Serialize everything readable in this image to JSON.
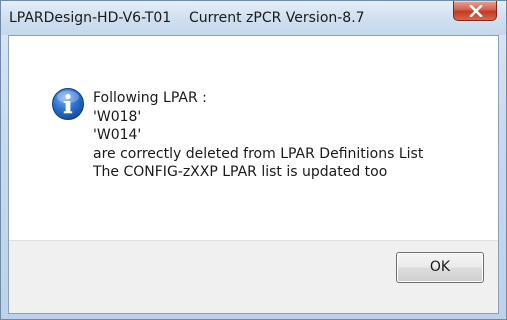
{
  "window": {
    "title": "LPARDesign-HD-V6-T01    Current zPCR Version-8.7",
    "close_icon": "close-icon"
  },
  "dialog": {
    "icon": "info-icon",
    "message_lines": [
      "Following LPAR :",
      "'W018'",
      "'W014'",
      "are correctly deleted from LPAR Definitions List",
      "The CONFIG-zXXP LPAR list is updated too"
    ],
    "ok_label": "OK"
  },
  "colors": {
    "close_button": "#c33b22",
    "info_icon": "#1f5fb8",
    "footer": "#f0f0f0"
  }
}
